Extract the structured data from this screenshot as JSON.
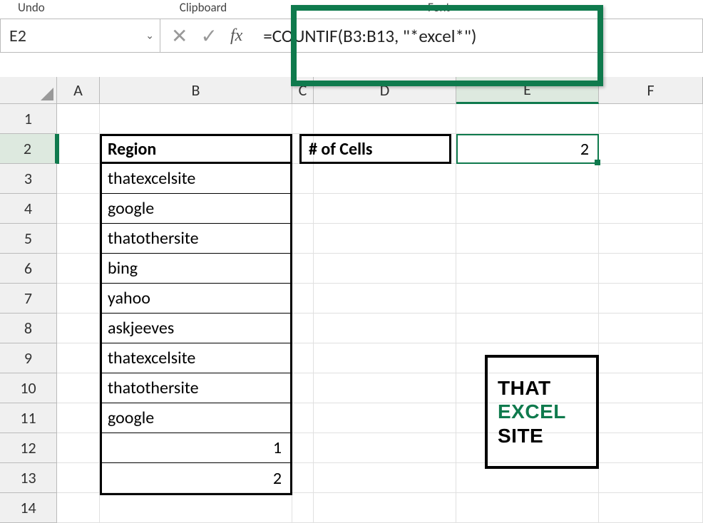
{
  "ribbon": {
    "undo": "Undo",
    "clipboard": "Clipboard",
    "font": "Font"
  },
  "nameBox": {
    "value": "E2"
  },
  "formulaBar": {
    "value": "=COUNTIF(B3:B13, \"*excel*\")"
  },
  "columns": [
    "A",
    "B",
    "C",
    "D",
    "E",
    "F"
  ],
  "rows": [
    "1",
    "2",
    "3",
    "4",
    "5",
    "6",
    "7",
    "8",
    "9",
    "10",
    "11",
    "12",
    "13",
    "14"
  ],
  "activeColumn": "E",
  "activeRow": "2",
  "dataTable": {
    "header": "Region",
    "values": [
      "thatexcelsite",
      "google",
      "thatothersite",
      "bing",
      "yahoo",
      "askjeeves",
      "thatexcelsite",
      "thatothersite",
      "google",
      "1",
      "2"
    ]
  },
  "resultBox": {
    "label": "# of Cells",
    "value": "2"
  },
  "logo": {
    "line1": "THAT",
    "line2": "EXCEL",
    "line3": "SITE"
  },
  "icons": {
    "cancel": "✕",
    "enter": "✓",
    "fx": "fx",
    "dropdown": "⌄"
  }
}
